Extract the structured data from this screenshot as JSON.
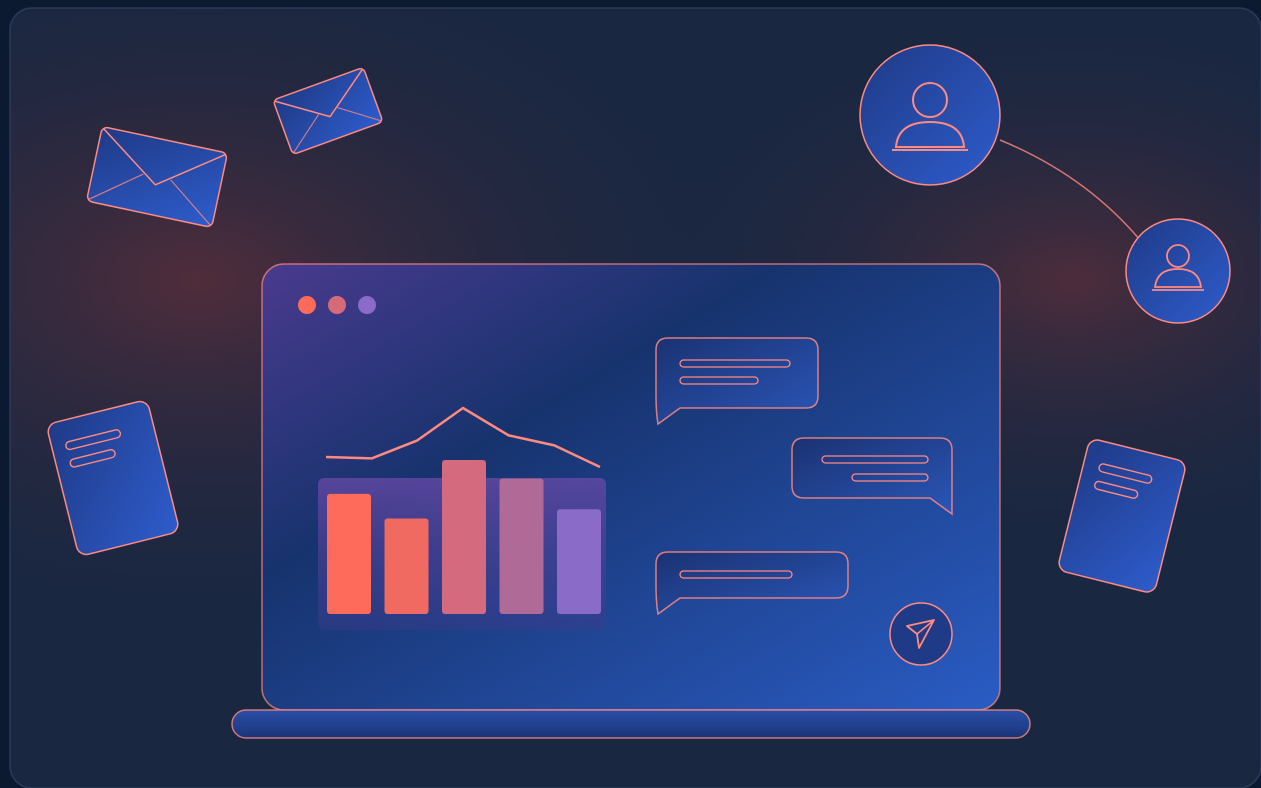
{
  "colors": {
    "page_background": "#0b1a30",
    "panel_background": "#1a2741",
    "panel_glow": "#5a2e3a",
    "accent_coral": "#ff6b5a",
    "accent_pink": "#e8727a",
    "accent_purple": "#8a6bc8",
    "screen_blue_dark": "#17336e",
    "screen_blue_light": "#2a5cc4",
    "outline_coral": "#ff8a80"
  },
  "illustration": {
    "window_dots": [
      "#ff6b5a",
      "#d76a78",
      "#8a6bc8"
    ],
    "chart_bars": [
      0.78,
      0.62,
      1.0,
      0.88,
      0.68
    ],
    "chart_bar_colors": [
      "#ff6b5a",
      "#f06a62",
      "#d46a7e",
      "#b06a98",
      "#8a6bc8"
    ],
    "chart_trend": [
      0.32,
      0.3,
      0.55,
      1.0,
      0.62,
      0.48,
      0.18
    ]
  },
  "icons": {
    "envelope_large": "envelope-icon",
    "envelope_small": "envelope-icon",
    "document_left": "document-icon",
    "document_right": "document-icon",
    "avatar_large": "user-avatar-icon",
    "avatar_small": "user-avatar-icon",
    "send": "paper-plane-icon"
  }
}
